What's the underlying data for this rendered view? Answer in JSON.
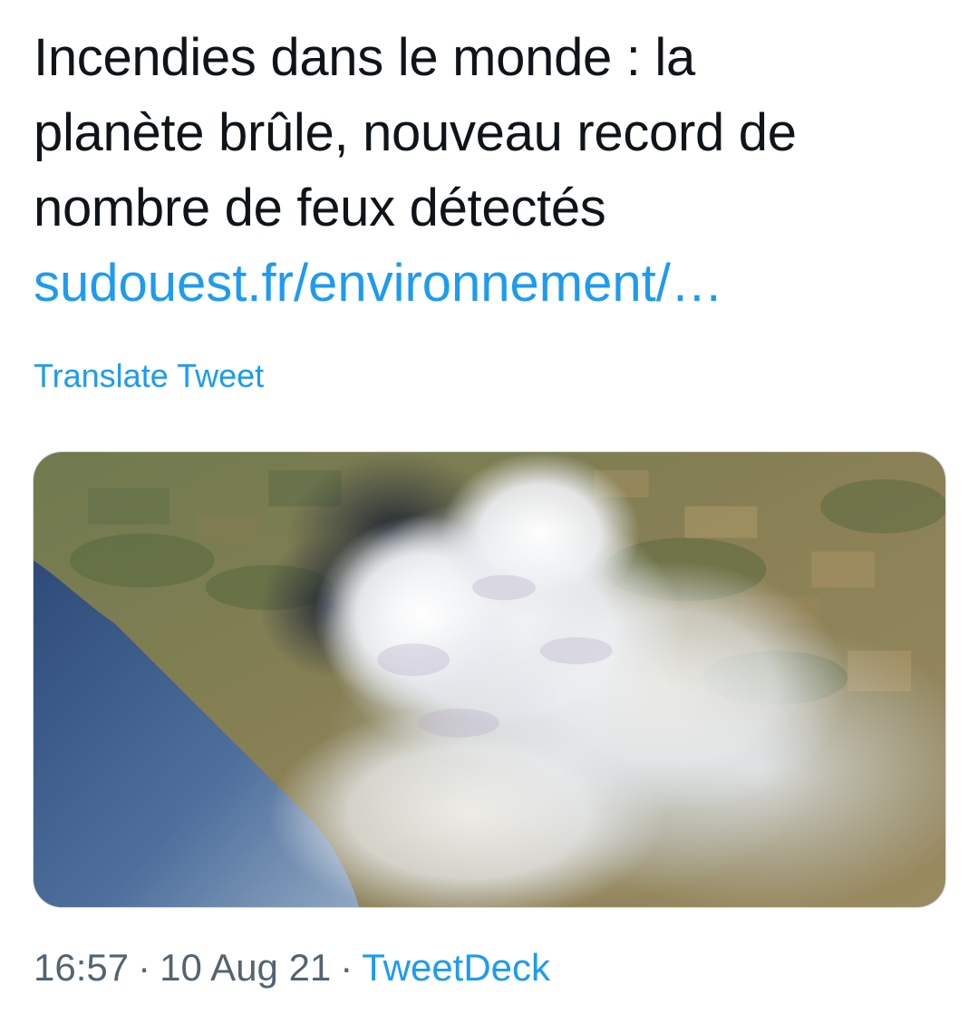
{
  "tweet": {
    "text_lines": [
      "Incendies dans le monde : la",
      "planète brûle, nouveau record de",
      "nombre de feux détectés"
    ],
    "link_text": "sudouest.fr/environnement/…",
    "translate_label": "Translate Tweet"
  },
  "media": {
    "kind": "satellite photo of wildfire smoke plume over coastline"
  },
  "meta": {
    "time": "16:57",
    "separator": "·",
    "date": "10 Aug 21",
    "source": "TweetDeck"
  },
  "colors": {
    "link": "#1d9bf0",
    "text": "#0f1419",
    "secondary": "#536471"
  }
}
